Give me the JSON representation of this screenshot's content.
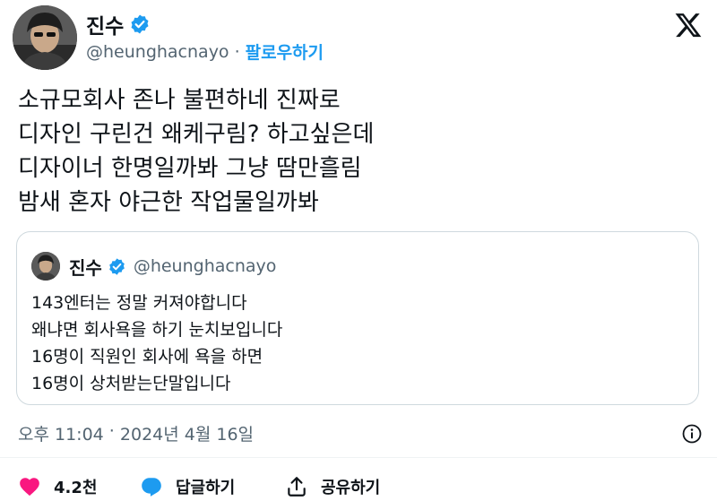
{
  "author": {
    "display_name": "진수",
    "handle": "@heunghacnayo",
    "separator": "·",
    "follow_label": "팔로우하기"
  },
  "tweet": {
    "lines": [
      "소규모회사 존나 불편하네 진짜로",
      "디자인 구린건 왜케구림? 하고싶은데",
      "디자이너 한명일까봐 그냥 땀만흘림",
      "밤새 혼자 야근한 작업물일까봐"
    ]
  },
  "quoted": {
    "display_name": "진수",
    "handle": "@heunghacnayo",
    "lines": [
      "143엔터는 정말 커져야합니다",
      "왜냐면 회사욕을 하기 눈치보입니다",
      "16명이 직원인 회사에 욕을 하면",
      "16명이 상처받는단말입니다"
    ]
  },
  "meta": {
    "time": "오후 11:04",
    "separator": " · ",
    "date": "2024년 4월 16일"
  },
  "actions": {
    "like_count": "4.2천",
    "reply_label": "답글하기",
    "share_label": "공유하기"
  },
  "colors": {
    "accent": "#1d9bf0",
    "like": "#f91880",
    "muted": "#536471"
  },
  "icons": [
    "verified-badge-icon",
    "x-logo-icon",
    "info-icon",
    "heart-icon",
    "reply-icon",
    "share-icon"
  ]
}
